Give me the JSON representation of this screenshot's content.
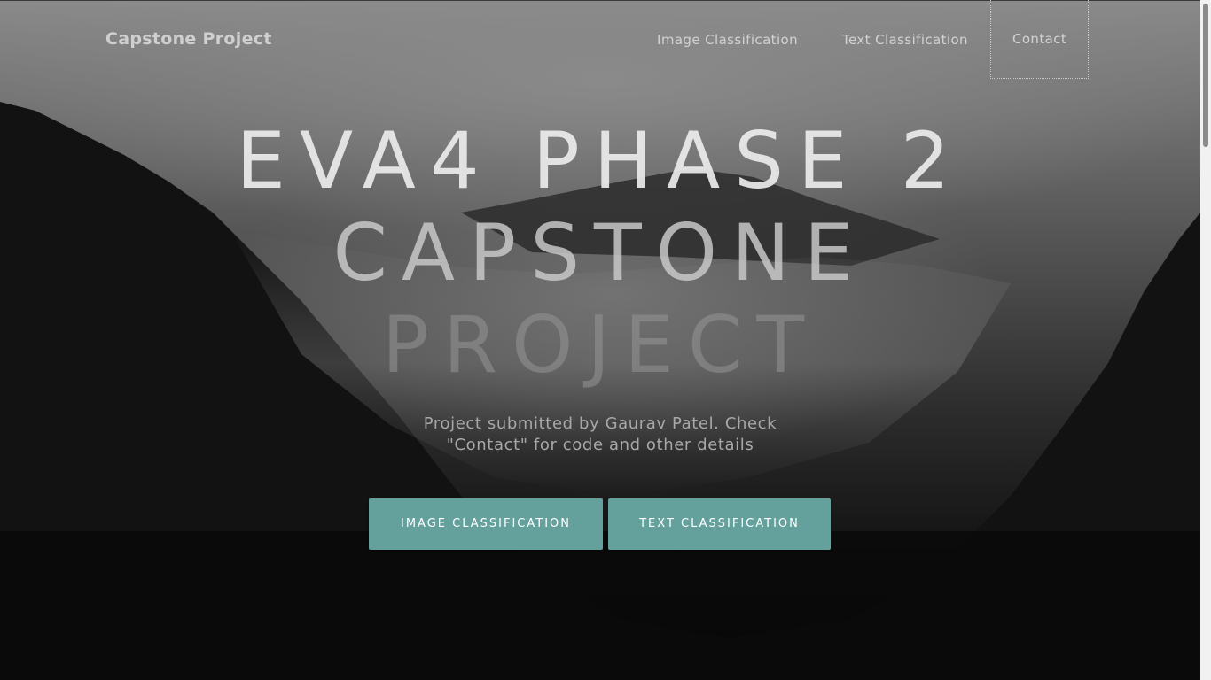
{
  "brand": "Capstone Project",
  "nav": {
    "items": [
      {
        "label": "Image Classification"
      },
      {
        "label": "Text Classification"
      },
      {
        "label": "Contact"
      }
    ]
  },
  "hero": {
    "title_lines": [
      "EVA4 PHASE 2",
      "CAPSTONE",
      "PROJECT"
    ],
    "subtitle_lines": [
      "Project submitted by Gaurav Patel. Check",
      "\"Contact\" for code and other details"
    ]
  },
  "buttons": {
    "image_classification": "IMAGE CLASSIFICATION",
    "text_classification": "TEXT CLASSIFICATION"
  },
  "colors": {
    "accent": "#64a19d"
  }
}
